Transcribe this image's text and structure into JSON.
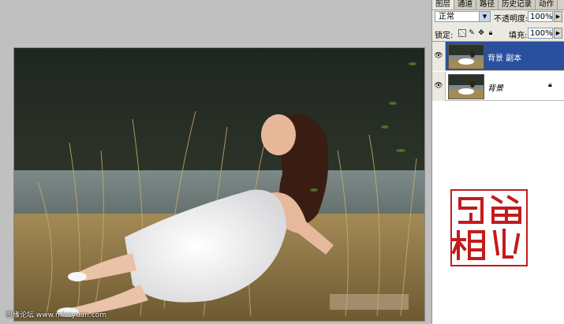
{
  "panel": {
    "tabs": [
      {
        "label": "图层"
      },
      {
        "label": "通道"
      },
      {
        "label": "路径"
      },
      {
        "label": "历史记录"
      },
      {
        "label": "动作"
      }
    ],
    "blend_mode": "正常",
    "opacity_label": "不透明度:",
    "opacity_value": "100%",
    "lock_label": "锁定:",
    "fill_label": "填充:",
    "fill_value": "100%",
    "layers": [
      {
        "name": "背景 副本",
        "selected": true
      },
      {
        "name": "背景",
        "selected": false,
        "locked": true
      }
    ]
  },
  "canvas": {
    "watermark": "思缘论坛 www.missyuan.com"
  },
  "seal": {
    "text": "简心石相"
  },
  "colors": {
    "selection": "#2a4f9d",
    "seal_red": "#c21c1c",
    "panel_bg": "#eceae0"
  },
  "icons": [
    "eye-icon",
    "lock-icon",
    "dropdown-arrow-icon",
    "move-icon",
    "brush-icon",
    "transparency-icon"
  ]
}
